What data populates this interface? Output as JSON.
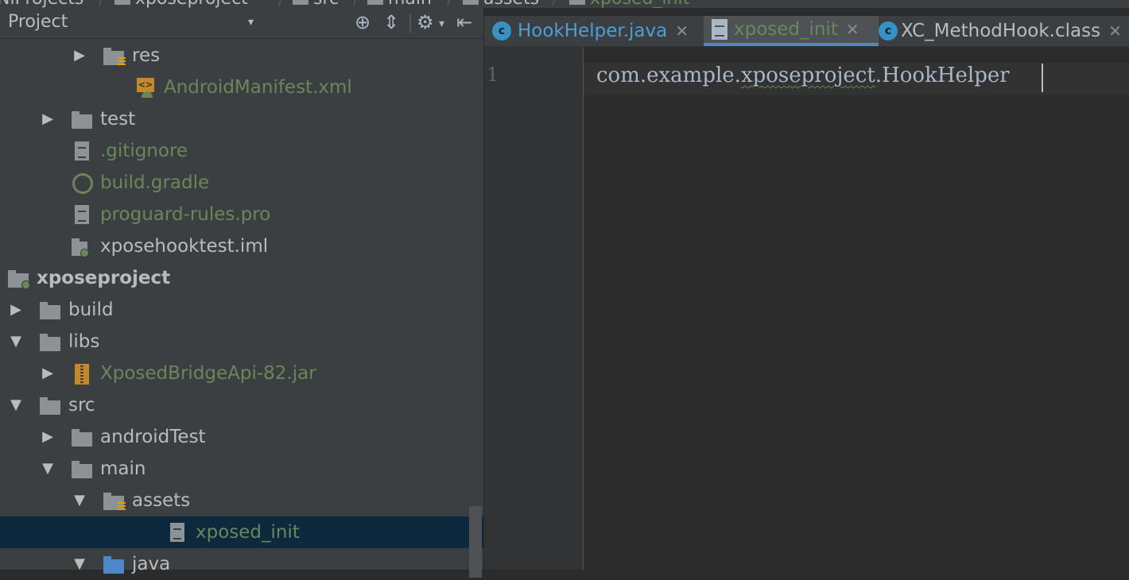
{
  "breadcrumb": {
    "items": [
      "NiProjects",
      "xposeproject",
      "src",
      "main",
      "assets",
      "xposed_init"
    ]
  },
  "project_panel": {
    "title": "Project",
    "dropdown": "▾",
    "tree": [
      {
        "label": "res",
        "arrow": "▶",
        "icon": "res-folder-icon",
        "color": "plain"
      },
      {
        "label": "AndroidManifest.xml",
        "arrow": "",
        "icon": "xml-icon",
        "color": "green"
      },
      {
        "label": "test",
        "arrow": "▶",
        "icon": "folder-icon",
        "color": "plain"
      },
      {
        "label": ".gitignore",
        "arrow": "",
        "icon": "file-icon",
        "color": "green"
      },
      {
        "label": "build.gradle",
        "arrow": "",
        "icon": "gradle-icon",
        "color": "green"
      },
      {
        "label": "proguard-rules.pro",
        "arrow": "",
        "icon": "file-icon",
        "color": "green"
      },
      {
        "label": "xposehooktest.iml",
        "arrow": "",
        "icon": "module-file-icon",
        "color": "plain"
      },
      {
        "label": "xposeproject",
        "arrow": "▼",
        "icon": "module-folder-icon",
        "color": "bold"
      },
      {
        "label": "build",
        "arrow": "▶",
        "icon": "folder-icon",
        "color": "plain"
      },
      {
        "label": "libs",
        "arrow": "▼",
        "icon": "folder-icon",
        "color": "plain"
      },
      {
        "label": "XposedBridgeApi-82.jar",
        "arrow": "▶",
        "icon": "jar-icon",
        "color": "green"
      },
      {
        "label": "src",
        "arrow": "▼",
        "icon": "folder-icon",
        "color": "plain"
      },
      {
        "label": "androidTest",
        "arrow": "▶",
        "icon": "folder-icon",
        "color": "plain"
      },
      {
        "label": "main",
        "arrow": "▼",
        "icon": "folder-icon",
        "color": "plain"
      },
      {
        "label": "assets",
        "arrow": "▼",
        "icon": "res-folder-icon",
        "color": "plain"
      },
      {
        "label": "xposed_init",
        "arrow": "",
        "icon": "file-icon",
        "color": "green",
        "selected": true
      },
      {
        "label": "java",
        "arrow": "▼",
        "icon": "blue-folder-icon",
        "color": "plain"
      }
    ]
  },
  "tabs": [
    {
      "label": "HookHelper.java",
      "icon": "class-icon",
      "active": false
    },
    {
      "label": "xposed_init",
      "icon": "text-file-icon",
      "active": true
    },
    {
      "label": "XC_MethodHook.class",
      "icon": "class-icon",
      "active": false
    }
  ],
  "editor": {
    "line_number": "1",
    "code_prefix": "com.example.",
    "code_squiggle": "xposeproject",
    "code_suffix": ".HookHelper"
  },
  "colors": {
    "accent": "#4a88c7",
    "green_text": "#6a8759",
    "selection": "#0d293e"
  }
}
